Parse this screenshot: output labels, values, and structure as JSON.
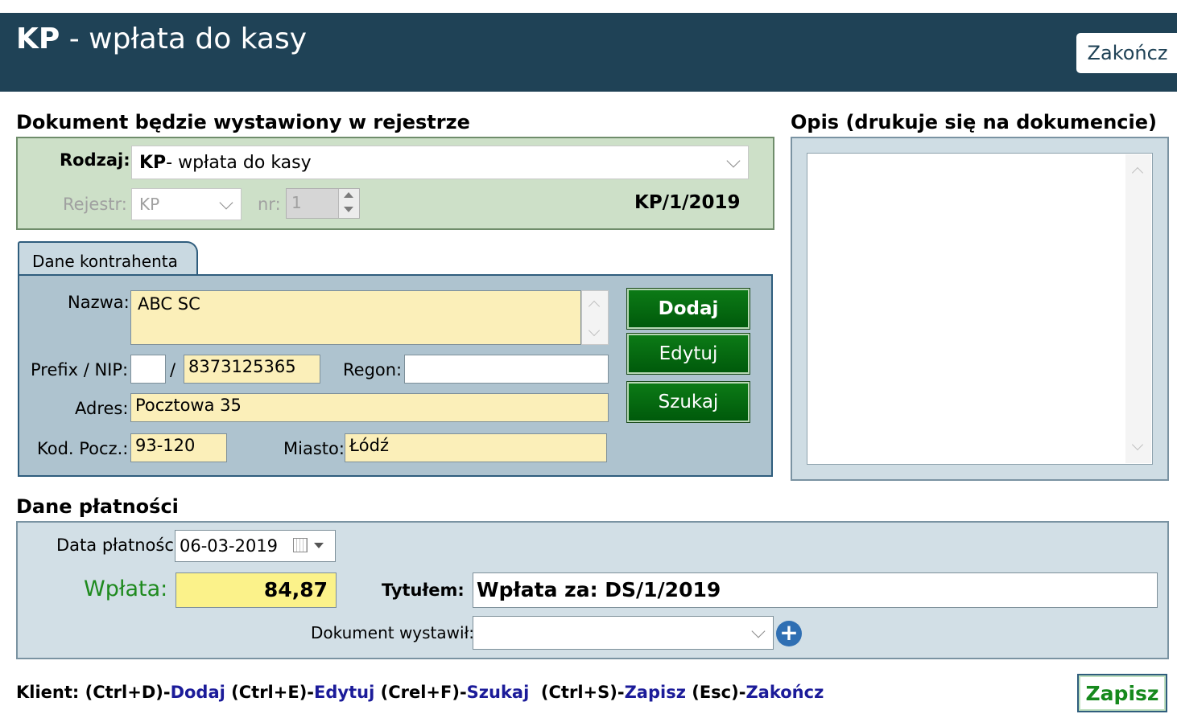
{
  "window": {
    "title_code": "KP",
    "title_rest": " - wpłata do kasy",
    "close_label": "Zakończ"
  },
  "register": {
    "section_title": "Dokument będzie wystawiony w rejestrze",
    "type_label": "Rodzaj:",
    "type_code": "KP",
    "type_rest": " - wpłata do kasy",
    "register_label": "Rejestr:",
    "register_value": "KP",
    "number_label": "nr:",
    "number_value": "1",
    "document_number": "KP/1/2019"
  },
  "contractor": {
    "tab_label": "Dane kontrahenta",
    "name_label": "Nazwa:",
    "name_value": "ABC SC",
    "nip_label": "Prefix / NIP:",
    "nip_prefix": "",
    "nip_separator": "/",
    "nip_value": "8373125365",
    "regon_label": "Regon:",
    "regon_value": "",
    "address_label": "Adres:",
    "address_value": "Pocztowa 35",
    "postcode_label": "Kod. Pocz.:",
    "postcode_value": "93-120",
    "city_label": "Miasto:",
    "city_value": "Łódź",
    "add_label": "Dodaj",
    "edit_label": "Edytuj",
    "search_label": "Szukaj"
  },
  "description": {
    "section_title": "Opis (drukuje się na dokumencie)",
    "value": ""
  },
  "payment": {
    "section_title": "Dane płatności",
    "date_label": "Data płatności:",
    "date_value": "06-03-2019",
    "amount_label": "Wpłata:",
    "amount_value": "84,87",
    "title_label": "Tytułem:",
    "title_value": "Wpłata za: DS/1/2019",
    "issuer_label": "Dokument wystawił:",
    "issuer_value": ""
  },
  "footer": {
    "prefix": "Klient: ",
    "k1": "(Ctrl+D)-",
    "a1": "Dodaj",
    "k2": " (Ctrl+E)-",
    "a2": "Edytuj",
    "k3": " (Crel+F)-",
    "a3": "Szukaj",
    "k4": "  (Ctrl+S)-",
    "a4": "Zapisz",
    "k5": " (Esc)-",
    "a5": "Zakończ",
    "save_label": "Zapisz"
  },
  "icons": {
    "date_picker": "calendar-icon",
    "add_issuer": "plus-circle-icon"
  },
  "colors": {
    "title_bar": "#1f4256",
    "register_panel": "#cde0c8",
    "contractor_panel": "#aec3cf",
    "button_green": "#0a6e12",
    "required_field": "#fbefb9",
    "amount_field": "#fbf28a"
  }
}
